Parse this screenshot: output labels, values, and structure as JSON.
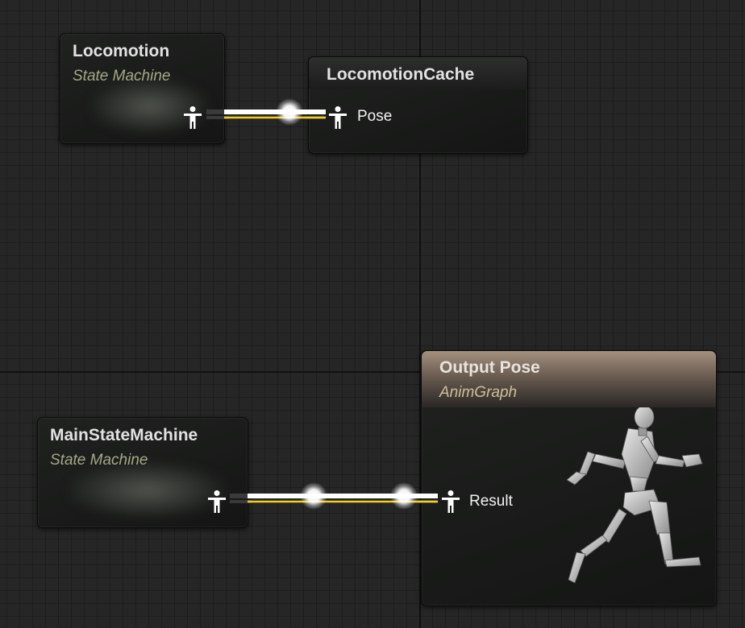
{
  "graph": {
    "nodes": {
      "locomotion": {
        "title": "Locomotion",
        "subtitle": "State Machine"
      },
      "locomotion_cache": {
        "title": "LocomotionCache",
        "pin_label": "Pose"
      },
      "main_state_machine": {
        "title": "MainStateMachine",
        "subtitle": "State Machine"
      },
      "output_pose": {
        "title": "Output Pose",
        "subtitle": "AnimGraph",
        "pin_label": "Result"
      }
    },
    "connections": [
      {
        "from": "Locomotion",
        "to": "LocomotionCache"
      },
      {
        "from": "MainStateMachine",
        "to": "Output Pose"
      }
    ]
  },
  "colors": {
    "background": "#262626",
    "wire": "#ffffff",
    "wire_accent": "#f2cf1e",
    "output_header": "#a4907f"
  },
  "icons": {
    "pose_pin": "person-pose-icon",
    "preview": "mannequin-running-icon"
  }
}
